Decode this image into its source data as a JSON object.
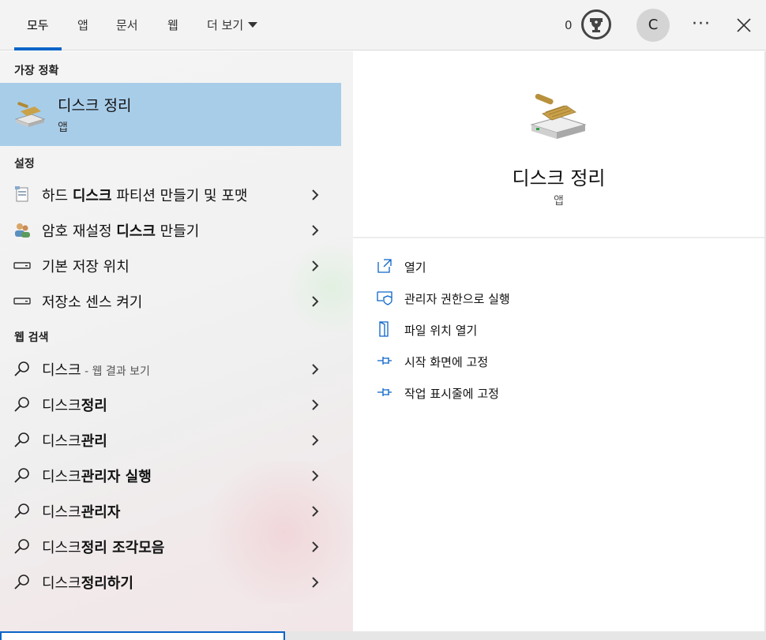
{
  "tabs": [
    {
      "label": "모두",
      "active": true
    },
    {
      "label": "앱"
    },
    {
      "label": "문서"
    },
    {
      "label": "웹"
    },
    {
      "label": "더 보기"
    }
  ],
  "header": {
    "points": "0",
    "avatar_initial": "C",
    "more_label": "···",
    "trophy_icon": "trophy-icon",
    "close_icon": "close-icon"
  },
  "best_match": {
    "heading": "가장 정확",
    "title": "디스크 정리",
    "subtitle": "앱",
    "icon": "disk-cleanup-icon"
  },
  "settings": {
    "heading": "설정",
    "items": [
      {
        "pre": "하드 ",
        "bold": "디스크",
        "post": " 파티션 만들기 및 포맷",
        "icon": "partition-icon"
      },
      {
        "pre": "암호 재설정 ",
        "bold": "디스크",
        "post": " 만들기",
        "icon": "users-icon"
      },
      {
        "pre": "기본 저장 위치",
        "bold": "",
        "post": "",
        "icon": "drive-icon"
      },
      {
        "pre": "저장소 센스 켜기",
        "bold": "",
        "post": "",
        "icon": "drive-icon"
      }
    ]
  },
  "web": {
    "heading": "웹 검색",
    "items": [
      {
        "pre": "디스크",
        "bold": "",
        "hint": " - 웹 결과 보기"
      },
      {
        "pre": "디스크",
        "bold": "정리",
        "hint": ""
      },
      {
        "pre": "디스크",
        "bold": "관리",
        "hint": ""
      },
      {
        "pre": "디스크",
        "bold": "관리자 실행",
        "hint": ""
      },
      {
        "pre": "디스크",
        "bold": "관리자",
        "hint": ""
      },
      {
        "pre": "디스크",
        "bold": "정리 조각모음",
        "hint": ""
      },
      {
        "pre": "디스크",
        "bold": "정리하기",
        "hint": ""
      }
    ]
  },
  "detail": {
    "title": "디스크 정리",
    "subtitle": "앱",
    "actions": [
      {
        "label": "열기",
        "icon": "open-icon"
      },
      {
        "label": "관리자 권한으로 실행",
        "icon": "shield-icon"
      },
      {
        "label": "파일 위치 열기",
        "icon": "file-location-icon"
      },
      {
        "label": "시작 화면에 고정",
        "icon": "pin-icon"
      },
      {
        "label": "작업 표시줄에 고정",
        "icon": "pin-icon"
      }
    ]
  },
  "colors": {
    "accent": "#0a64c8",
    "selection": "#a8cde9"
  }
}
